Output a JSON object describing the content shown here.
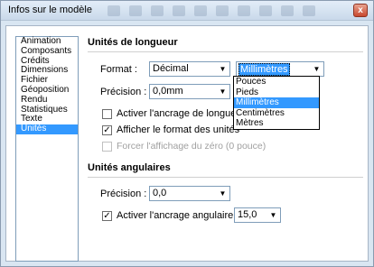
{
  "window": {
    "title": "Infos sur le modèle",
    "close_glyph": "x"
  },
  "sidebar": {
    "items": [
      {
        "label": "Animation"
      },
      {
        "label": "Composants"
      },
      {
        "label": "Crédits"
      },
      {
        "label": "Dimensions"
      },
      {
        "label": "Fichier"
      },
      {
        "label": "Géoposition"
      },
      {
        "label": "Rendu"
      },
      {
        "label": "Statistiques"
      },
      {
        "label": "Texte"
      },
      {
        "label": "Unités"
      }
    ],
    "selected": "Unités"
  },
  "length_units": {
    "title": "Unités de longueur",
    "format_label": "Format :",
    "format_value": "Décimal",
    "unit_value": "Millimètres",
    "unit_options": [
      "Pouces",
      "Pieds",
      "Millimètres",
      "Centimètres",
      "Mètres"
    ],
    "unit_selected": "Millimètres",
    "precision_label": "Précision :",
    "precision_value": "0,0mm",
    "snap_label": "Activer l'ancrage de longueur",
    "snap_checked": false,
    "show_format_label": "Afficher le format des unités",
    "show_format_checked": true,
    "force_zero_label": "Forcer l'affichage du zéro (0 pouce)",
    "force_zero_checked": false,
    "force_zero_disabled": true
  },
  "angular_units": {
    "title": "Unités angulaires",
    "precision_label": "Précision :",
    "precision_value": "0,0",
    "snap_label": "Activer l'ancrage angulaire",
    "snap_checked": true,
    "snap_value": "15,0"
  },
  "glyphs": {
    "combo_arrow": "▼",
    "check_mark": "✓"
  }
}
